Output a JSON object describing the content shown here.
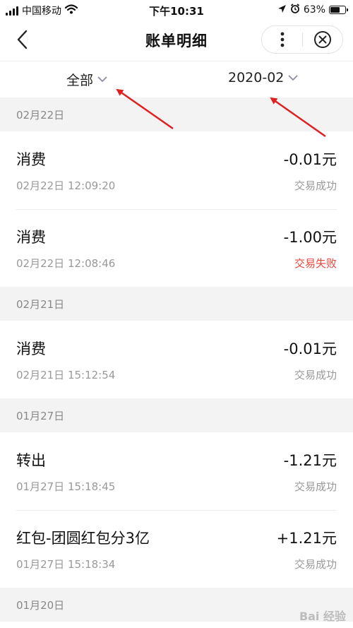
{
  "status_bar": {
    "carrier": "中国移动",
    "time": "下午10:31",
    "battery": "63%"
  },
  "nav": {
    "title": "账单明细",
    "back_icon": "chevron-left-icon",
    "more_icon": "more-vertical-icon",
    "close_icon": "circle-close-icon"
  },
  "filters": {
    "type_label": "全部",
    "month_label": "2020-02"
  },
  "sections": [
    {
      "date": "02月22日",
      "items": [
        {
          "title": "消费",
          "time": "02月22日 12:09:20",
          "amount": "-0.01元",
          "status": "交易成功",
          "failed": false
        },
        {
          "title": "消费",
          "time": "02月22日 12:08:46",
          "amount": "-1.00元",
          "status": "交易失败",
          "failed": true
        }
      ]
    },
    {
      "date": "02月21日",
      "items": [
        {
          "title": "消费",
          "time": "02月21日 15:12:54",
          "amount": "-0.01元",
          "status": "交易成功",
          "failed": false
        }
      ]
    },
    {
      "date": "01月27日",
      "items": [
        {
          "title": "转出",
          "time": "01月27日 15:18:45",
          "amount": "-1.21元",
          "status": "交易成功",
          "failed": false
        },
        {
          "title": "红包-团圆红包分3亿",
          "time": "01月27日 15:18:34",
          "amount": "+1.21元",
          "status": "交易成功",
          "failed": false
        }
      ]
    },
    {
      "date": "01月20日",
      "items": []
    }
  ],
  "watermark": "Bai 经验",
  "colors": {
    "section_bg": "#f3f3f3",
    "fail_red": "#e8453c",
    "annotation_red": "#e02020"
  }
}
